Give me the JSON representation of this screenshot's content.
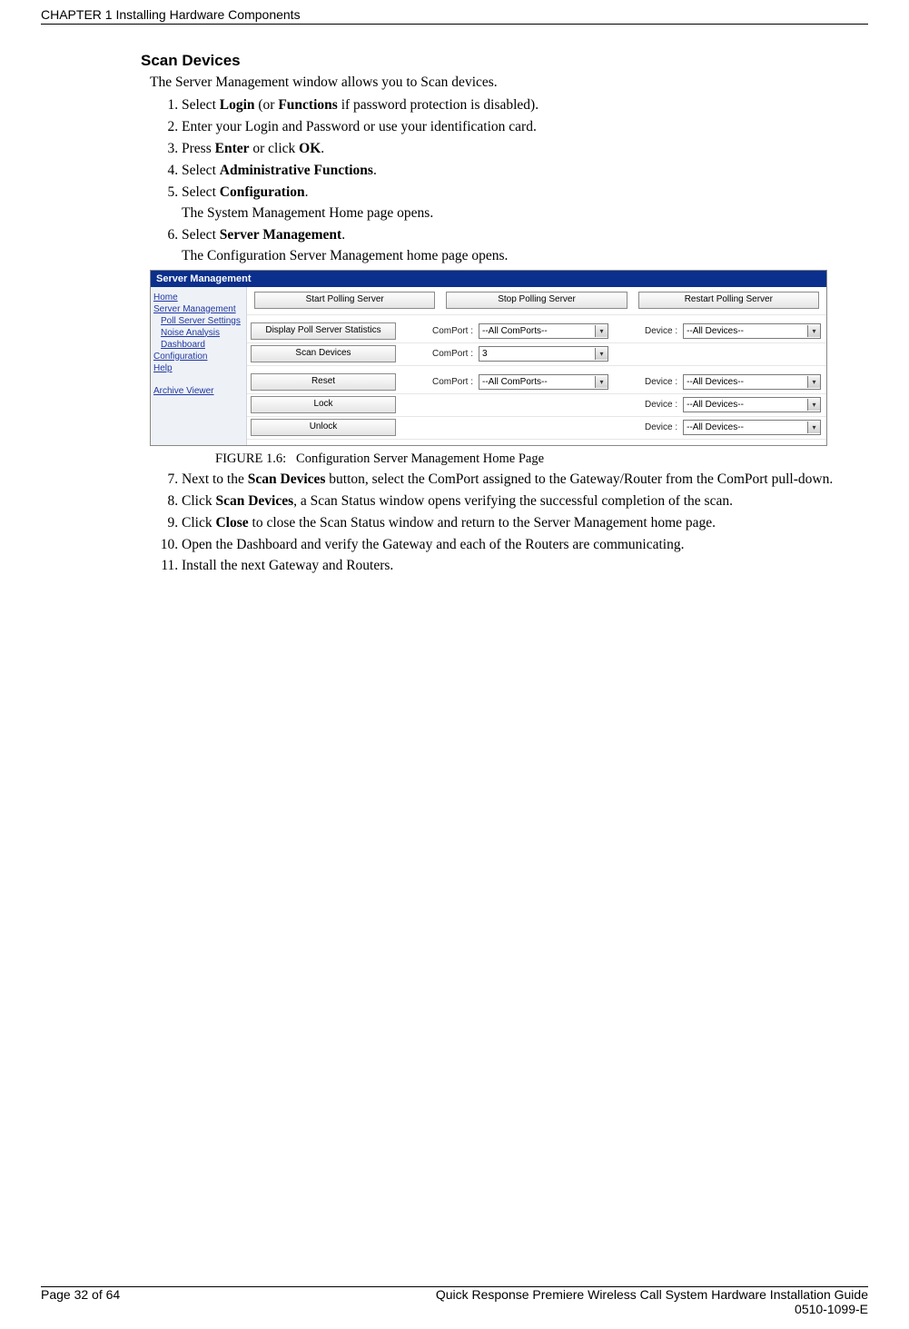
{
  "header": {
    "chapter": "CHAPTER 1 Installing Hardware Components"
  },
  "heading": "Scan Devices",
  "intro": "The Server Management window allows you to Scan devices.",
  "steps1": {
    "s1_pre": "Select ",
    "s1_b1": "Login",
    "s1_mid": " (or ",
    "s1_b2": "Functions",
    "s1_post": " if password protection is disabled).",
    "s2": "Enter your Login and Password or use your identification card.",
    "s3_pre": "Press ",
    "s3_b1": "Enter",
    "s3_mid": " or click ",
    "s3_b2": "OK",
    "s3_post": ".",
    "s4_pre": "Select ",
    "s4_b": "Administrative Functions",
    "s4_post": ".",
    "s5_pre": "Select ",
    "s5_b": "Configuration",
    "s5_post": ".",
    "s5_note": "The System Management Home page opens.",
    "s6_pre": "Select ",
    "s6_b": "Server Management",
    "s6_post": ".",
    "s6_note": "The Configuration Server Management home page opens."
  },
  "screenshot": {
    "title": "Server Management",
    "sidebar": {
      "home": "Home",
      "server_mgmt": "Server Management",
      "poll": "Poll Server Settings",
      "noise": "Noise Analysis",
      "dashboard": "Dashboard",
      "configuration": "Configuration",
      "help": "Help",
      "archive": "Archive Viewer"
    },
    "buttons": {
      "start": "Start Polling Server",
      "stop": "Stop Polling Server",
      "restart": "Restart Polling Server",
      "stats": "Display Poll Server Statistics",
      "scan": "Scan Devices",
      "reset": "Reset",
      "lock": "Lock",
      "unlock": "Unlock"
    },
    "labels": {
      "comport": "ComPort :",
      "device": "Device :"
    },
    "selects": {
      "allcom": "--All ComPorts--",
      "alldev": "--All Devices--",
      "three": "3"
    }
  },
  "figure_caption_label": "FIGURE 1.6:",
  "figure_caption_text": "Configuration Server Management Home Page",
  "steps2": {
    "s7_pre": "Next to the ",
    "s7_b": "Scan Devices",
    "s7_post": " button, select the ComPort assigned to the Gateway/Router from the ComPort pull-down.",
    "s8_pre": "Click ",
    "s8_b": "Scan Devices",
    "s8_post": ", a Scan Status window opens verifying the successful completion of the scan.",
    "s9_pre": "Click ",
    "s9_b": "Close",
    "s9_post": " to close the Scan Status window and return to the Server Management home page.",
    "s10": "Open the Dashboard and verify the Gateway and each of the Routers are communicating.",
    "s11": "Install the next Gateway and Routers."
  },
  "footer": {
    "page": "Page 32 of 64",
    "guide": "Quick Response Premiere Wireless Call System Hardware Installation Guide",
    "docnum": "0510-1099-E"
  }
}
